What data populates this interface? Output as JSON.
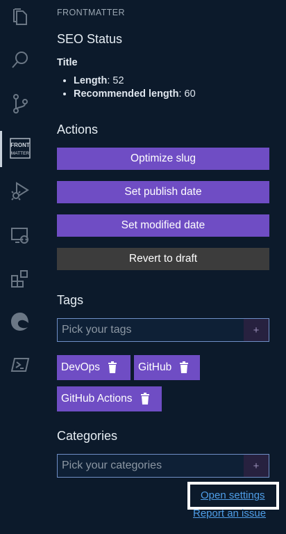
{
  "activity_bar": {
    "items": [
      {
        "icon": "files-icon"
      },
      {
        "icon": "search-icon"
      },
      {
        "icon": "source-control-icon"
      },
      {
        "icon": "frontmatter-icon",
        "label_top": "FRONT",
        "label_bottom": "MATTER"
      },
      {
        "icon": "run-debug-icon"
      },
      {
        "icon": "remote-explorer-icon"
      },
      {
        "icon": "extensions-icon"
      },
      {
        "icon": "edge-icon"
      },
      {
        "icon": "powershell-icon"
      }
    ]
  },
  "panel": {
    "section_label": "FRONTMATTER",
    "seo": {
      "heading": "SEO Status",
      "title_heading": "Title",
      "length_label": "Length",
      "length_value": ": 52",
      "recommended_label": "Recommended length",
      "recommended_value": ": 60"
    },
    "actions": {
      "heading": "Actions",
      "optimize_slug": "Optimize slug",
      "set_publish_date": "Set publish date",
      "set_modified_date": "Set modified date",
      "revert_to_draft": "Revert to draft"
    },
    "tags": {
      "heading": "Tags",
      "placeholder": "Pick your tags",
      "add_symbol": "+",
      "items": [
        "DevOps",
        "GitHub",
        "GitHub Actions"
      ]
    },
    "categories": {
      "heading": "Categories",
      "placeholder": "Pick your categories",
      "add_symbol": "+"
    },
    "links": {
      "open_settings": "Open settings",
      "report_issue": "Report an issue"
    }
  },
  "colors": {
    "background": "#0c1a2b",
    "accent_purple": "#6f4dc4",
    "gray_button": "#3c3c3c",
    "link": "#4f9ee8"
  }
}
